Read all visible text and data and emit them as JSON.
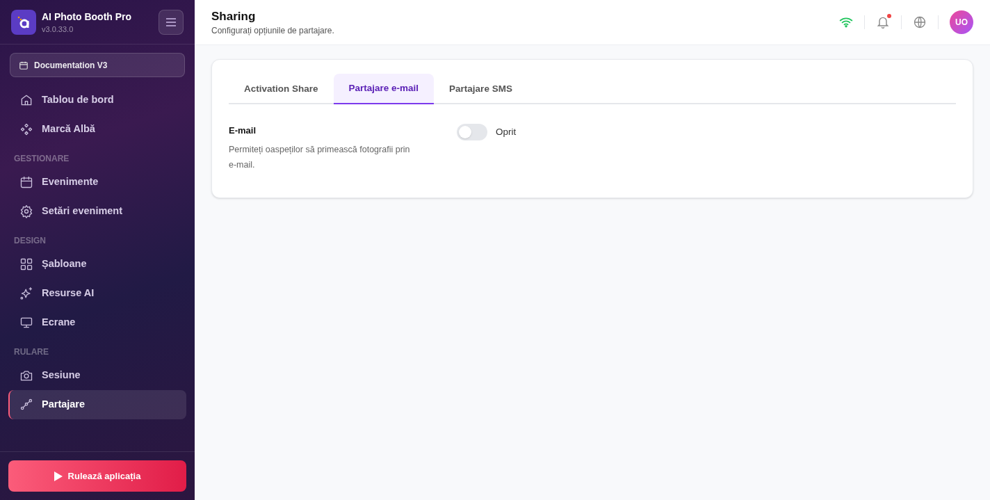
{
  "app": {
    "name": "AI Photo Booth Pro",
    "version": "v3.0.33.0"
  },
  "event_selector": {
    "label": "Documentation V3"
  },
  "sidebar": {
    "sections": [
      {
        "items": [
          {
            "label": "Tablou de bord",
            "kind": "home",
            "selected": false
          },
          {
            "label": "Marcă Albă",
            "kind": "diamonds",
            "selected": false
          }
        ]
      },
      {
        "title": "GESTIONARE",
        "items": [
          {
            "label": "Evenimente",
            "kind": "calendar",
            "selected": false
          },
          {
            "label": "Setări eveniment",
            "kind": "gear",
            "selected": false
          }
        ]
      },
      {
        "title": "DESIGN",
        "items": [
          {
            "label": "Șabloane",
            "kind": "grid",
            "selected": false
          },
          {
            "label": "Resurse AI",
            "kind": "sparkle",
            "selected": false
          },
          {
            "label": "Ecrane",
            "kind": "monitor",
            "selected": false
          }
        ]
      },
      {
        "title": "RULARE",
        "items": [
          {
            "label": "Sesiune",
            "kind": "camera",
            "selected": false
          },
          {
            "label": "Partajare",
            "kind": "share",
            "selected": true
          }
        ]
      }
    ]
  },
  "run_button": {
    "label": "Rulează aplicația"
  },
  "header": {
    "title": "Sharing",
    "subtitle": "Configurați opțiunile de partajare.",
    "avatar": "UO",
    "notification_dot": true
  },
  "tabs": [
    {
      "label": "Activation Share",
      "selected": false
    },
    {
      "label": "Partajare e-mail",
      "selected": true
    },
    {
      "label": "Partajare SMS",
      "selected": false
    }
  ],
  "settings": [
    {
      "title": "E-mail",
      "description": "Permiteți oaspeților să primească fotografii prin e-mail.",
      "on": false,
      "state_label": "Oprit"
    }
  ]
}
